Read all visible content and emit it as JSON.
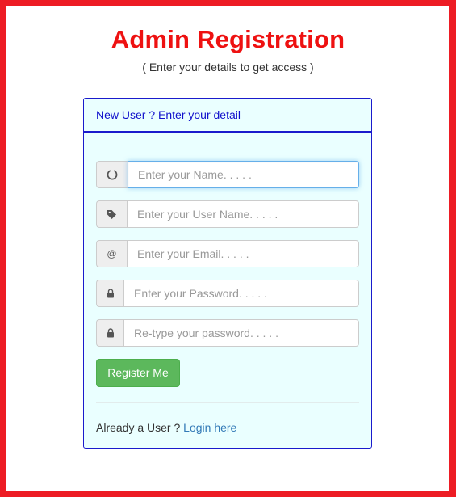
{
  "header": {
    "title": "Admin Registration",
    "subtitle": "( Enter your details to get access )"
  },
  "panel": {
    "heading": "New User ? Enter your detail"
  },
  "form": {
    "name": {
      "placeholder": "Enter your Name. . . . .",
      "value": "",
      "icon": "circle-notch-icon"
    },
    "username": {
      "placeholder": "Enter your User Name. . . . .",
      "value": "",
      "icon": "tag-icon"
    },
    "email": {
      "placeholder": "Enter your Email. . . . .",
      "value": "",
      "icon": "at-sign",
      "addon_text": "@"
    },
    "password": {
      "placeholder": "Enter your Password. . . . .",
      "value": "",
      "icon": "lock-icon"
    },
    "retype_password": {
      "placeholder": "Re-type your password. . . . .",
      "value": "",
      "icon": "lock-icon"
    },
    "submit_label": "Register Me"
  },
  "footer": {
    "text": "Already a User ? ",
    "link_label": "Login here"
  },
  "colors": {
    "frame_border": "#ed1c24",
    "title": "#ee1111",
    "panel_background": "#eaffff",
    "panel_border": "#1a1acc",
    "button": "#5cb85c",
    "link": "#337ab7"
  }
}
